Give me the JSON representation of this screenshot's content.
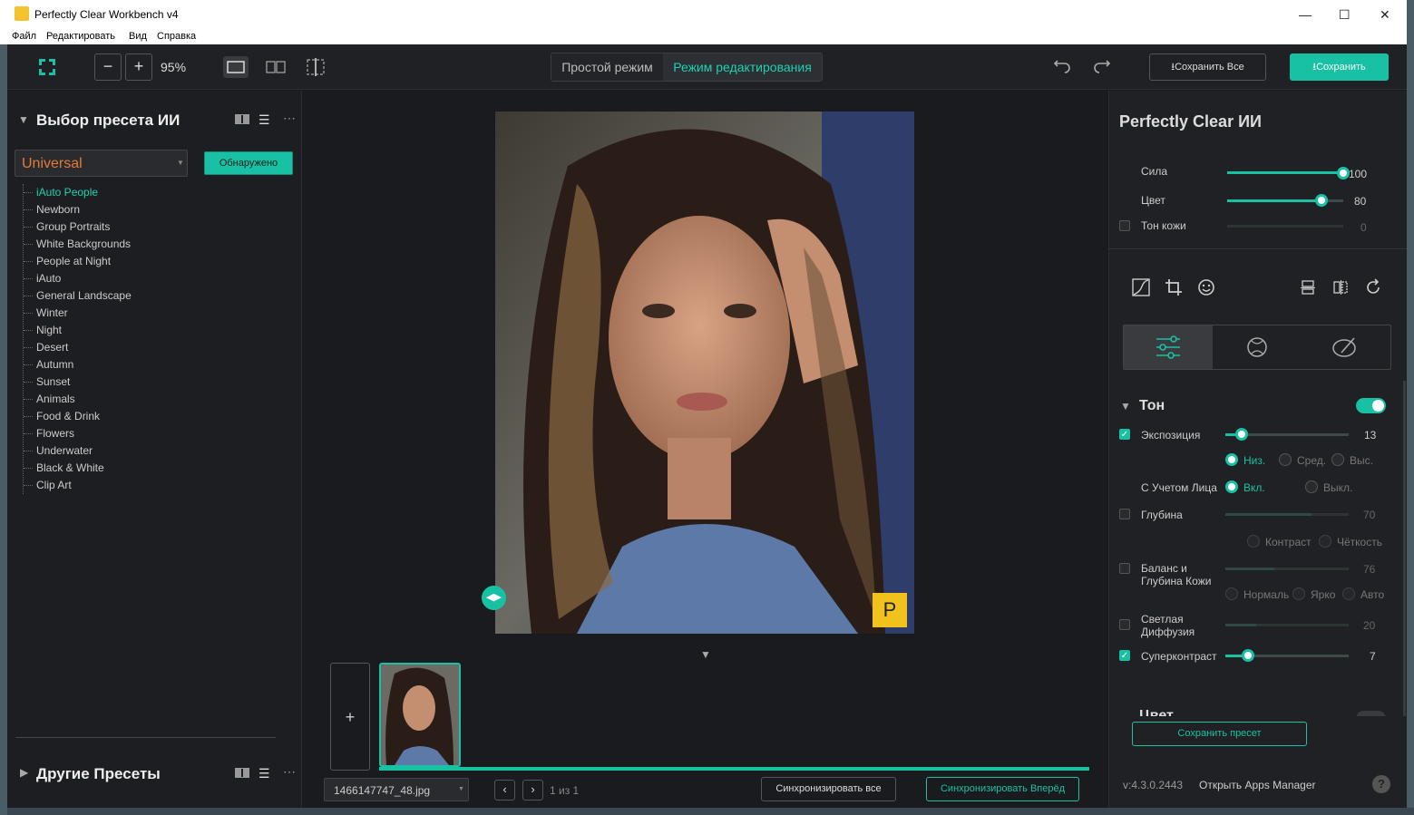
{
  "window": {
    "title": "Perfectly Clear Workbench v4",
    "minimize": "—",
    "maximize": "☐",
    "close": "✕"
  },
  "menu": [
    "Файл",
    "Редактировать",
    "Вид",
    "Справка"
  ],
  "toolbar": {
    "zoom": "95%",
    "mode_simple": "Простой режим",
    "mode_edit": "Режим редактирования",
    "save_all": "Сохранить Все",
    "save": "Сохранить"
  },
  "left": {
    "ai_title": "Выбор пресета ИИ",
    "category": "Universal",
    "detected": "Обнаружено",
    "presets": [
      "iAuto People",
      "Newborn",
      "Group Portraits",
      "White Backgrounds",
      "People at Night",
      "iAuto",
      "General Landscape",
      "Winter",
      "Night",
      "Desert",
      "Autumn",
      "Sunset",
      "Animals",
      "Food & Drink",
      "Flowers",
      "Underwater",
      "Black & White",
      "Clip Art"
    ],
    "active_preset": "iAuto People",
    "other_title": "Другие Пресеты"
  },
  "center": {
    "badge": "P",
    "filename": "1466147747_48.jpg",
    "page": "1 из 1",
    "sync_all": "Синхронизировать все",
    "sync_forward": "Синхронизировать Вперёд"
  },
  "right": {
    "title": "Perfectly Clear ИИ",
    "strength": {
      "label": "Сила",
      "value": "100",
      "level": 1.0
    },
    "color": {
      "label": "Цвет",
      "value": "80",
      "level": 0.8
    },
    "skin_tone": {
      "label": "Тон кожи",
      "value": "0"
    },
    "section_tone": "Тон",
    "exposure": {
      "label": "Экспозиция",
      "value": "13",
      "level": 0.13
    },
    "exp_low": "Низ.",
    "exp_mid": "Сред.",
    "exp_high": "Выс.",
    "face_aware": "С Учетом Лица",
    "on": "Вкл.",
    "off": "Выкл.",
    "depth": {
      "label": "Глубина",
      "value": "70",
      "level": 0.7
    },
    "contrast": "Контраст",
    "clarity": "Чёткость",
    "skin_balance": {
      "label1": "Баланс и",
      "label2": "Глубина Кожи",
      "value": "76",
      "level": 0.4
    },
    "normal": "Нормаль",
    "bright": "Ярко",
    "auto": "Авто",
    "diffusion": {
      "label1": "Светлая",
      "label2": "Диффузия",
      "value": "20",
      "level": 0.25
    },
    "supercontrast": {
      "label": "Суперконтраст",
      "value": "7",
      "level": 0.18
    },
    "section_color": "Цвет",
    "save_preset": "Сохранить пресет",
    "version": "v:4.3.0.2443",
    "apps_manager": "Открыть Apps Manager",
    "help": "?"
  },
  "colors": {
    "accent": "#18c1a3",
    "active_preset": "#1fd1b0",
    "category": "#e07b3a"
  }
}
